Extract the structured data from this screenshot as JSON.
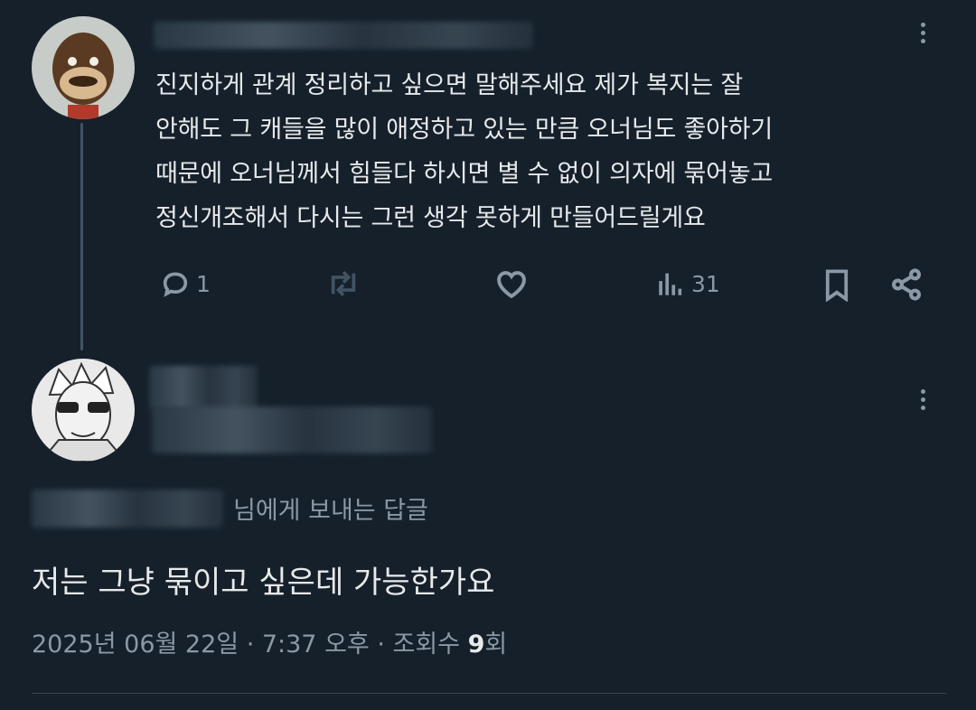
{
  "parent_tweet": {
    "text": "진지하게 관계 정리하고 싶으면 말해주세요  제가 복지는 잘\n안해도 그 캐들을 많이 애정하고 있는 만큼 오너님도 좋아하기\n때문에 오너님께서 힘들다 하시면 별 수 없이 의자에 묶어놓고\n정신개조해서 다시는 그런 생각 못하게 만들어드릴게요",
    "reply_count": "1",
    "view_count": "31"
  },
  "reply_tweet": {
    "replying_suffix": "님에게 보내는 답글",
    "text": "저는  그냥 묶이고 싶은데 가능한가요",
    "date": "2025년 06월 22일 · 7:37 오후 · 조회수 ",
    "views_number": "9",
    "views_suffix": "회"
  },
  "colors": {
    "background": "#15202b",
    "text": "#e7e9ea",
    "secondary": "#8b98a5",
    "line": "#425364"
  }
}
